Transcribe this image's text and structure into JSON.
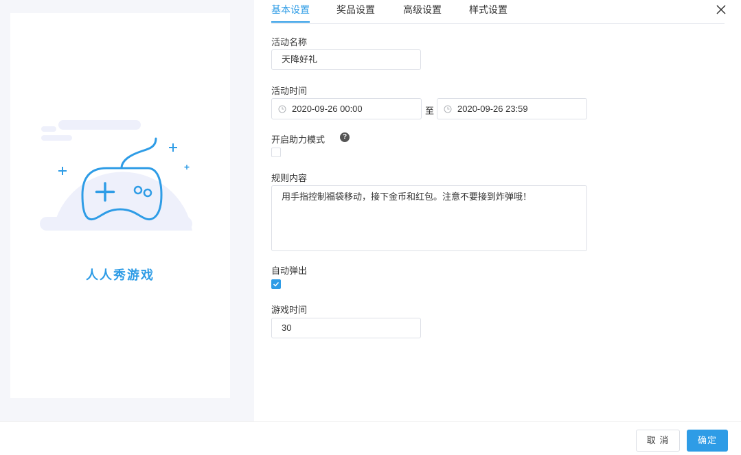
{
  "preview": {
    "game_title": "人人秀游戏",
    "illustration": "gamepad-icon"
  },
  "tabs": [
    {
      "label": "基本设置",
      "active": true
    },
    {
      "label": "奖品设置",
      "active": false
    },
    {
      "label": "高级设置",
      "active": false
    },
    {
      "label": "样式设置",
      "active": false
    }
  ],
  "form": {
    "activity_name": {
      "label": "活动名称",
      "value": "天降好礼"
    },
    "activity_time": {
      "label": "活动时间",
      "start": "2020-09-26 00:00",
      "separator": "至",
      "end": "2020-09-26 23:59"
    },
    "assist_mode": {
      "label": "开启助力模式",
      "help": "?",
      "checked": false
    },
    "rules": {
      "label": "规则内容",
      "value": "用手指控制福袋移动，接下金币和红包。注意不要接到炸弹哦！"
    },
    "auto_popup": {
      "label": "自动弹出",
      "checked": true
    },
    "game_time": {
      "label": "游戏时间",
      "value": "30"
    }
  },
  "footer": {
    "cancel_label": "取 消",
    "confirm_label": "确定"
  },
  "colors": {
    "accent": "#2e9ce6",
    "panel_bg": "#f5f6fa",
    "illustration_bg": "#eef0fb"
  }
}
